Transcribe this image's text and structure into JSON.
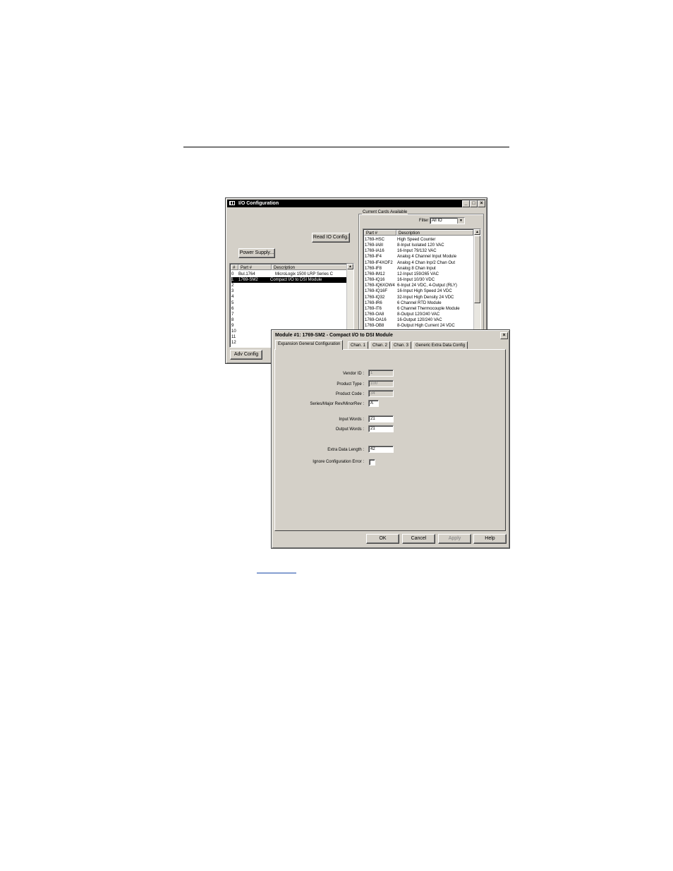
{
  "io_window": {
    "title": "I/O Configuration",
    "title_icon": "grid-icon",
    "read_io_config_label": "Read IO Config.",
    "power_supply_label": "Power Supply...",
    "adv_config_label": "Adv Config",
    "slots_headers": [
      "#",
      "Part #",
      "Description"
    ],
    "slots": [
      {
        "num": "0",
        "part": "Bul.1764",
        "desc": "MicroLogix 1500 LRP Series C"
      },
      {
        "num": "1",
        "part": "1769-SM2",
        "desc": "Compact I/O to DSI Module"
      },
      {
        "num": "2",
        "part": "",
        "desc": ""
      },
      {
        "num": "3",
        "part": "",
        "desc": ""
      },
      {
        "num": "4",
        "part": "",
        "desc": ""
      },
      {
        "num": "5",
        "part": "",
        "desc": ""
      },
      {
        "num": "6",
        "part": "",
        "desc": ""
      },
      {
        "num": "7",
        "part": "",
        "desc": ""
      },
      {
        "num": "8",
        "part": "",
        "desc": ""
      },
      {
        "num": "9",
        "part": "",
        "desc": ""
      },
      {
        "num": "10",
        "part": "",
        "desc": ""
      },
      {
        "num": "11",
        "part": "",
        "desc": ""
      },
      {
        "num": "12",
        "part": "",
        "desc": ""
      }
    ],
    "current_cards_label": "Current Cards Available",
    "filter_label": "Filter",
    "filter_value": "All IO",
    "cards_headers": [
      "Part #",
      "Description"
    ],
    "cards": [
      {
        "part": "1769-HSC",
        "desc": "High Speed Counter"
      },
      {
        "part": "1769-IA8I",
        "desc": "8-Input Isolated 120 VAC"
      },
      {
        "part": "1769-IA16",
        "desc": "16-Input 79/132 VAC"
      },
      {
        "part": "1769-IF4",
        "desc": "Analog  4 Channel Input Module"
      },
      {
        "part": "1769-IF4XOF2",
        "desc": "Analog 4 Chan Inp/2 Chan Out"
      },
      {
        "part": "1769-IF8",
        "desc": "Analog 8 Chan Input"
      },
      {
        "part": "1769-IM12",
        "desc": "12-Input 159/265 VAC"
      },
      {
        "part": "1769-IQ16",
        "desc": "16-Input 10/30 VDC"
      },
      {
        "part": "1769-IQ6XOW4",
        "desc": "6-Input 24 VDC, 4-Output (RLY)"
      },
      {
        "part": "1769-IQ16F",
        "desc": "16-Input High Speed 24 VDC"
      },
      {
        "part": "1769-IQ32",
        "desc": "32-Input High Density 24 VDC"
      },
      {
        "part": "1769-IR6",
        "desc": "6 Channel RTD Module"
      },
      {
        "part": "1769-IT6",
        "desc": "6 Channel Thermocouple Module"
      },
      {
        "part": "1769-OA8",
        "desc": "8-Output 120/240 VAC"
      },
      {
        "part": "1769-OA16",
        "desc": "16-Output 120/240 VAC"
      },
      {
        "part": "1769-OB8",
        "desc": "8-Output High Current 24 VDC"
      }
    ]
  },
  "module_dialog": {
    "title": "Module #1: 1769-SM2 - Compact I/O to DSI Module",
    "close_glyph": "×",
    "tabs": [
      "Expansion General Configuration",
      "Chan. 1",
      "Chan. 2",
      "Chan. 3",
      "Generic Extra Data Config"
    ],
    "fields": {
      "vendor_id": {
        "label": "Vendor ID :",
        "value": "1"
      },
      "product_type": {
        "label": "Product Type :",
        "value": "100"
      },
      "product_code": {
        "label": "Product Code :",
        "value": "34"
      },
      "series_rev": {
        "label": "Series/Major Rev/MinorRev :",
        "value": "A"
      },
      "input_words": {
        "label": "Input Words :",
        "value": "21"
      },
      "output_words": {
        "label": "Output Words :",
        "value": "21"
      },
      "extra_data_length": {
        "label": "Extra Data Length :",
        "value": "42"
      },
      "ignore_config_error": {
        "label": "Ignore Configuration Error :"
      }
    },
    "buttons": {
      "ok": "OK",
      "cancel": "Cancel",
      "apply": "Apply",
      "help": "Help"
    }
  }
}
